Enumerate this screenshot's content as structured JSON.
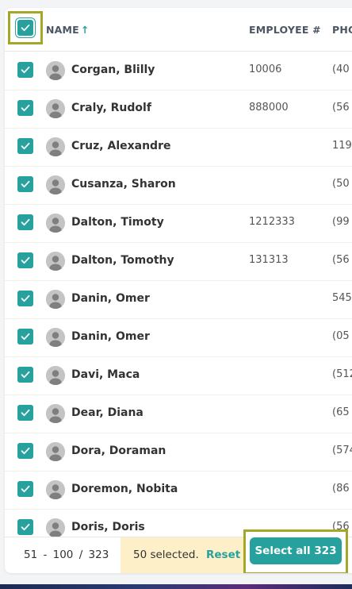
{
  "header": {
    "name_label": "NAME",
    "sort_arrow": "↑",
    "employee_label": "EMPLOYEE #",
    "phone_label": "PHO"
  },
  "rows": [
    {
      "name": "Corgan, Blilly",
      "employee": "10006",
      "phone": "(40"
    },
    {
      "name": "Craly, Rudolf",
      "employee": "888000",
      "phone": "(56"
    },
    {
      "name": "Cruz, Alexandre",
      "employee": "",
      "phone": "1191"
    },
    {
      "name": "Cusanza, Sharon",
      "employee": "",
      "phone": "(50"
    },
    {
      "name": "Dalton, Timoty",
      "employee": "1212333",
      "phone": "(99"
    },
    {
      "name": "Dalton, Tomothy",
      "employee": "131313",
      "phone": "(56"
    },
    {
      "name": "Danin, Omer",
      "employee": "",
      "phone": "545"
    },
    {
      "name": "Danin, Omer",
      "employee": "",
      "phone": "(05"
    },
    {
      "name": "Davi, Maca",
      "employee": "",
      "phone": "(512"
    },
    {
      "name": "Dear, Diana",
      "employee": "",
      "phone": "(65"
    },
    {
      "name": "Dora, Doraman",
      "employee": "",
      "phone": "(574"
    },
    {
      "name": "Doremon, Nobita",
      "employee": "",
      "phone": "(86"
    },
    {
      "name": "Doris, Doris",
      "employee": "",
      "phone": "(56"
    }
  ],
  "footer": {
    "pager": "51 - 100 / 323",
    "selected_text": "50 selected.",
    "reset_label": "Reset",
    "select_all_label": "Select all 323"
  },
  "colors": {
    "accent": "#26a19e",
    "highlight_border": "#a4a826",
    "selection_bar": "#fdf0c8"
  },
  "icons": {
    "checkbox": "check-icon",
    "avatar": "user-avatar-icon"
  }
}
